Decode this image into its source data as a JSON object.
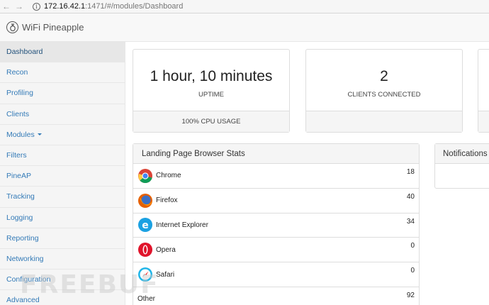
{
  "browser": {
    "url_host": "172.16.42.1",
    "url_rest": ":1471/#/modules/Dashboard"
  },
  "app": {
    "brand": "WiFi Pineapple"
  },
  "sidebar": {
    "items": [
      {
        "label": "Dashboard"
      },
      {
        "label": "Recon"
      },
      {
        "label": "Profiling"
      },
      {
        "label": "Clients"
      },
      {
        "label": "Modules"
      },
      {
        "label": "Filters"
      },
      {
        "label": "PineAP"
      },
      {
        "label": "Tracking"
      },
      {
        "label": "Logging"
      },
      {
        "label": "Reporting"
      },
      {
        "label": "Networking"
      },
      {
        "label": "Configuration"
      },
      {
        "label": "Advanced"
      }
    ]
  },
  "stats": {
    "uptime_value": "1 hour, 10 minutes",
    "uptime_label": "UPTIME",
    "cpu_footer": "100% CPU USAGE",
    "clients_value": "2",
    "clients_label": "CLIENTS CONNECTED"
  },
  "browser_stats": {
    "title": "Landing Page Browser Stats",
    "rows": [
      {
        "name": "Chrome",
        "count": "18",
        "icon": "chrome-icon"
      },
      {
        "name": "Firefox",
        "count": "40",
        "icon": "firefox-icon"
      },
      {
        "name": "Internet Explorer",
        "count": "34",
        "icon": "internet-explorer-icon"
      },
      {
        "name": "Opera",
        "count": "0",
        "icon": "opera-icon"
      },
      {
        "name": "Safari",
        "count": "0",
        "icon": "safari-icon"
      },
      {
        "name": "Other",
        "count": "92"
      }
    ]
  },
  "notifications": {
    "title": "Notifications"
  },
  "watermark": "FREEBUF",
  "colors": {
    "link": "#337ab7",
    "panel_bg": "#f5f5f5",
    "border": "#dddddd"
  }
}
